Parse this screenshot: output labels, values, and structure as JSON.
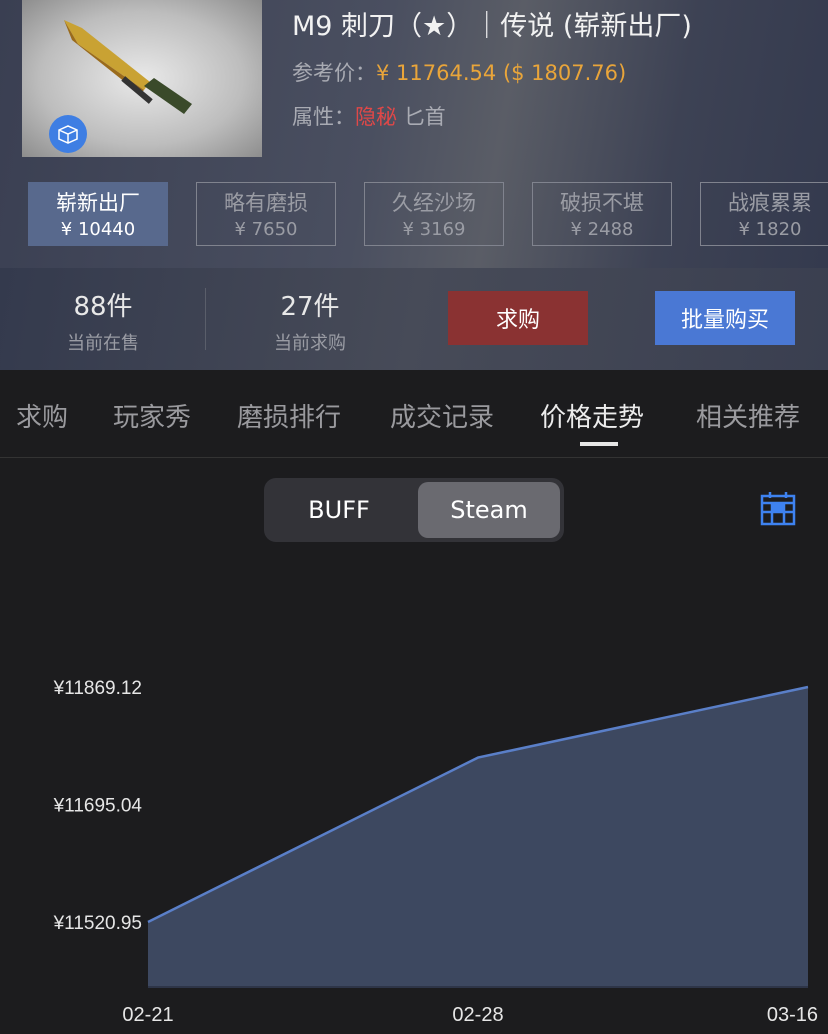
{
  "item": {
    "title": "M9 刺刀（★）｜传说 (崭新出厂)",
    "ref_label": "参考价：",
    "ref_price_cny": "¥ 11764.54",
    "ref_price_usd": "($ 1807.76)",
    "attr_label": "属性：",
    "rarity": "隐秘",
    "type": "匕首",
    "badge_icon": "3d-box-icon"
  },
  "wears": [
    {
      "name": "崭新出厂",
      "price": "¥ 10440",
      "selected": true
    },
    {
      "name": "略有磨损",
      "price": "¥ 7650"
    },
    {
      "name": "久经沙场",
      "price": "¥ 3169"
    },
    {
      "name": "破损不堪",
      "price": "¥ 2488"
    },
    {
      "name": "战痕累累",
      "price": "¥ 1820"
    }
  ],
  "stats": {
    "on_sale_count": "88件",
    "on_sale_label": "当前在售",
    "buy_orders_count": "27件",
    "buy_orders_label": "当前求购"
  },
  "buttons": {
    "buy_order": "求购",
    "bulk_buy": "批量购买"
  },
  "tabs": [
    "求购",
    "玩家秀",
    "磨损排行",
    "成交记录",
    "价格走势",
    "相关推荐"
  ],
  "active_tab": "价格走势",
  "source_toggle": {
    "options": [
      "BUFF",
      "Steam"
    ],
    "selected": "Steam"
  },
  "colors": {
    "accent": "#4a78d4",
    "buy_order": "#8a3232",
    "line": "#5a7fc8",
    "area": "#3d4860",
    "rarity": "#e04848",
    "price": "#e9a53a"
  },
  "chart_data": {
    "type": "area",
    "categories": [
      "02-21",
      "02-28",
      "03-16"
    ],
    "values": [
      11520.95,
      11764.54,
      11869.12
    ],
    "yticks": [
      "¥11869.12",
      "¥11695.04",
      "¥11520.95"
    ],
    "ytick_values": [
      11869.12,
      11695.04,
      11520.95
    ],
    "ylim": [
      11424.6,
      11975.8
    ],
    "grid": false
  }
}
